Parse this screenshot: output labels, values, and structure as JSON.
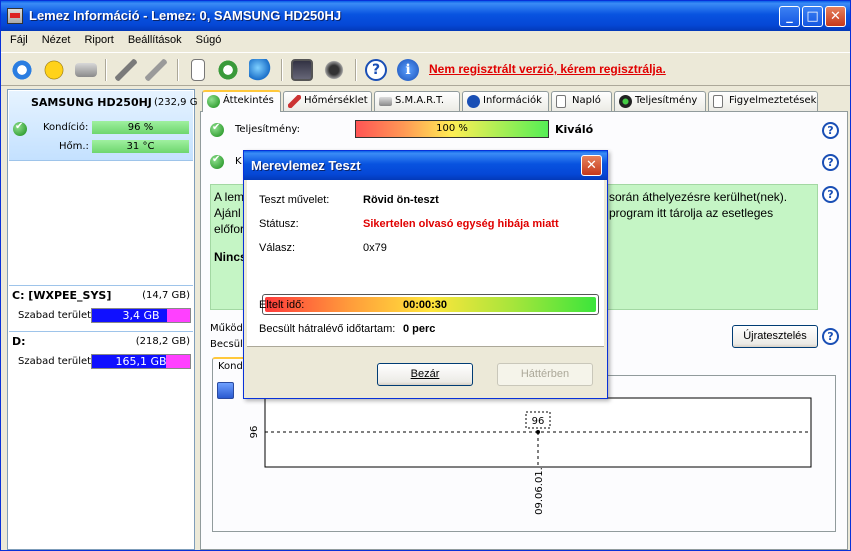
{
  "window": {
    "title": "Lemez Információ - Lemez: 0, SAMSUNG HD250HJ",
    "min": "_",
    "max": "□",
    "close": "✕"
  },
  "menu": [
    "Fájl",
    "Nézet",
    "Riport",
    "Beállítások",
    "Súgó"
  ],
  "unregistered": "Nem regisztrált verzió, kérem regisztrálja.",
  "left": {
    "drive_name": "SAMSUNG HD250HJ",
    "drive_size": "(232,9 G",
    "condition_label": "Kondíció:",
    "condition_value": "96 %",
    "temp_label": "Hőm.:",
    "temp_value": "31 °C",
    "volumes": [
      {
        "name": "C: [WXPEE_SYS]",
        "size": "(14,7 GB)",
        "free_label": "Szabad terület",
        "free_value": "3,4 GB",
        "used_fraction": 0.77
      },
      {
        "name": "D:",
        "size": "(218,2 GB)",
        "free_label": "Szabad terület",
        "free_value": "165,1 GB",
        "used_fraction": 0.76
      }
    ]
  },
  "tabs": [
    "Áttekintés",
    "Hőmérséklet",
    "S.M.A.R.T.",
    "Információk",
    "Napló",
    "Teljesítmény",
    "Figyelmeztetések"
  ],
  "overview": {
    "perf_label": "Teljesítmény:",
    "perf_value": "100 %",
    "perf_word": "Kiváló",
    "row2_label": "K",
    "info_lines": [
      "A lem",
      "Ajánl",
      "előfor",
      "Nincs"
    ],
    "info_right_1": "során áthelyezésre kerülhet(nek).",
    "info_right_2": "program itt tárolja az esetleges",
    "operating_label": "Működ",
    "estimated_label": "Becsül",
    "retest_button": "Újratesztelés",
    "subtab": "Kond",
    "chart": {
      "point_label": "96",
      "y_tick": "96",
      "x_tick": "09.06.01."
    }
  },
  "chart_data": {
    "type": "line",
    "x": [
      "09.06.01."
    ],
    "series": [
      {
        "values": [
          96
        ]
      }
    ]
  },
  "dialog": {
    "title": "Merevlemez Teszt",
    "close": "✕",
    "op_label": "Teszt művelet:",
    "op_value": "Rövid ön-teszt",
    "status_label": "Státusz:",
    "status_value": "Sikertelen olvasó egység hibája miatt",
    "answer_label": "Válasz:",
    "answer_value": "0x79",
    "progress": 1.0,
    "elapsed_label": "Eltelt idő:",
    "elapsed_value": "00:00:30",
    "remaining_label": "Becsült hátralévő időtartam:",
    "remaining_value": "0 perc",
    "close_button": "Bezár",
    "background_button": "Háttérben"
  }
}
